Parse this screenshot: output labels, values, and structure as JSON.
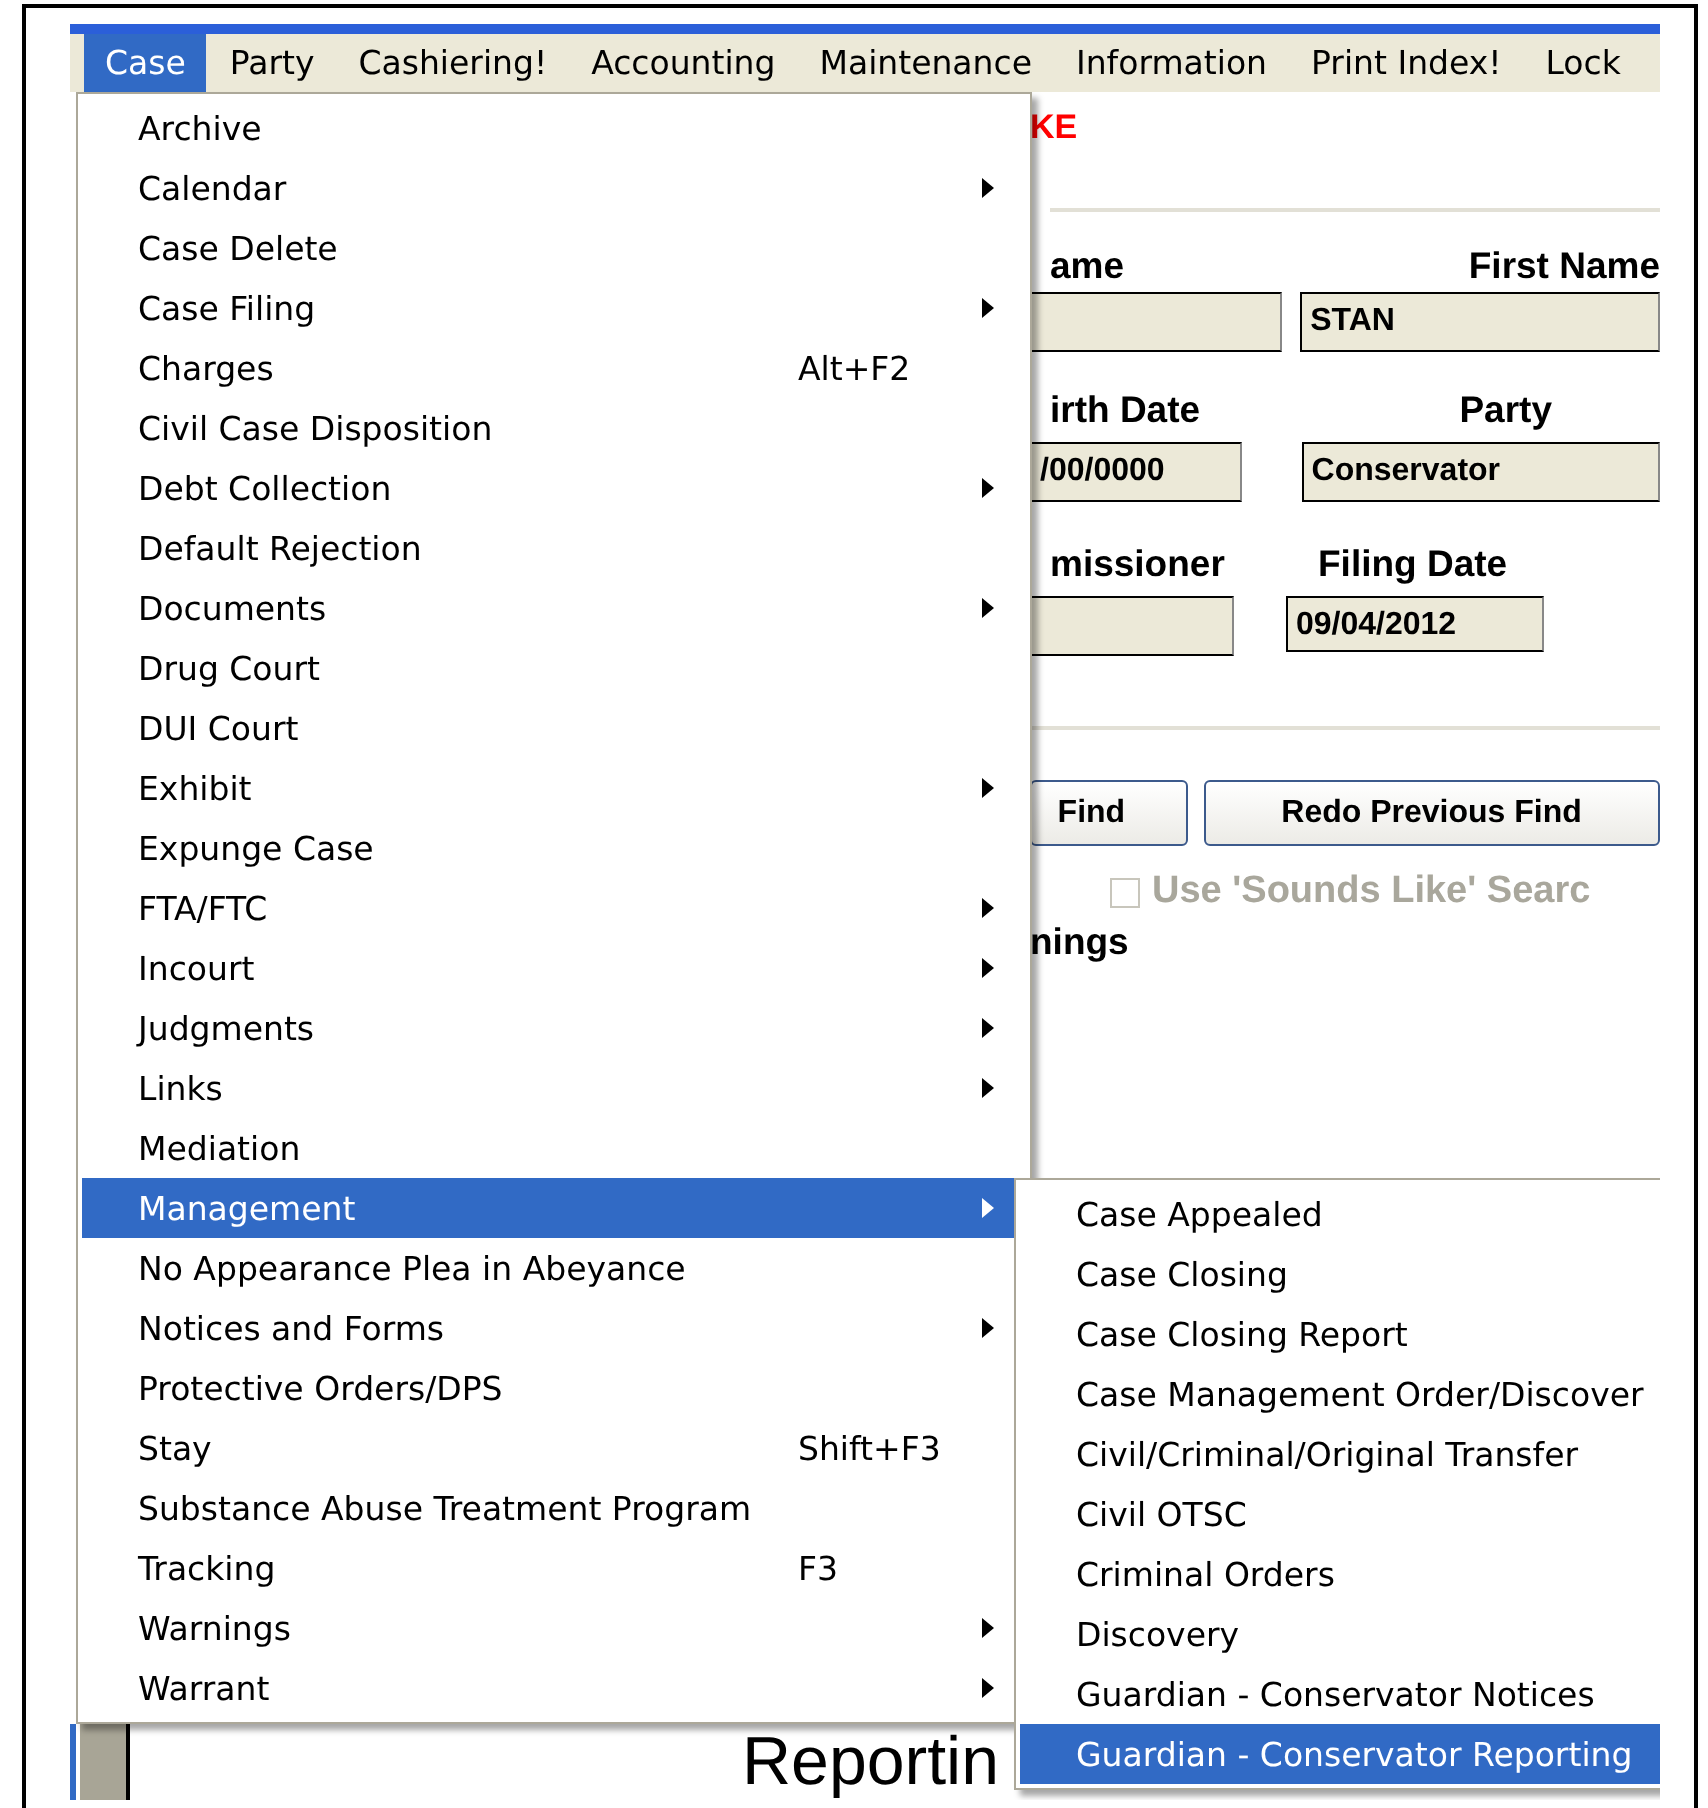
{
  "menubar": {
    "items": [
      {
        "label": "Case",
        "selected": true
      },
      {
        "label": "Party",
        "selected": false
      },
      {
        "label": "Cashiering!",
        "selected": false
      },
      {
        "label": "Accounting",
        "selected": false
      },
      {
        "label": "Maintenance",
        "selected": false
      },
      {
        "label": "Information",
        "selected": false
      },
      {
        "label": "Print Index!",
        "selected": false
      },
      {
        "label": "Lock",
        "selected": false
      }
    ]
  },
  "case_menu": {
    "items": [
      {
        "label": "Archive",
        "has_submenu": false,
        "selected": false
      },
      {
        "label": "Calendar",
        "has_submenu": true,
        "selected": false
      },
      {
        "label": "Case Delete",
        "has_submenu": false,
        "selected": false
      },
      {
        "label": "Case Filing",
        "has_submenu": true,
        "selected": false
      },
      {
        "label": "Charges",
        "shortcut": "Alt+F2",
        "has_submenu": false,
        "selected": false
      },
      {
        "label": "Civil Case Disposition",
        "has_submenu": false,
        "selected": false
      },
      {
        "label": "Debt Collection",
        "has_submenu": true,
        "selected": false
      },
      {
        "label": "Default Rejection",
        "has_submenu": false,
        "selected": false
      },
      {
        "label": "Documents",
        "has_submenu": true,
        "selected": false
      },
      {
        "label": "Drug Court",
        "has_submenu": false,
        "selected": false
      },
      {
        "label": "DUI Court",
        "has_submenu": false,
        "selected": false
      },
      {
        "label": "Exhibit",
        "has_submenu": true,
        "selected": false
      },
      {
        "label": "Expunge Case",
        "has_submenu": false,
        "selected": false
      },
      {
        "label": "FTA/FTC",
        "has_submenu": true,
        "selected": false
      },
      {
        "label": "Incourt",
        "has_submenu": true,
        "selected": false
      },
      {
        "label": "Judgments",
        "has_submenu": true,
        "selected": false
      },
      {
        "label": "Links",
        "has_submenu": true,
        "selected": false
      },
      {
        "label": "Mediation",
        "has_submenu": false,
        "selected": false
      },
      {
        "label": "Management",
        "has_submenu": true,
        "selected": true
      },
      {
        "label": "No Appearance Plea in Abeyance",
        "has_submenu": false,
        "selected": false
      },
      {
        "label": "Notices and Forms",
        "has_submenu": true,
        "selected": false
      },
      {
        "label": "Protective Orders/DPS",
        "has_submenu": false,
        "selected": false
      },
      {
        "label": "Stay",
        "shortcut": "Shift+F3",
        "has_submenu": false,
        "selected": false
      },
      {
        "label": "Substance Abuse Treatment Program",
        "has_submenu": false,
        "selected": false
      },
      {
        "label": "Tracking",
        "shortcut": "F3",
        "has_submenu": false,
        "selected": false
      },
      {
        "label": "Warnings",
        "has_submenu": true,
        "selected": false
      },
      {
        "label": "Warrant",
        "has_submenu": true,
        "selected": false
      }
    ]
  },
  "management_submenu": {
    "items": [
      {
        "label": "Case Appealed",
        "selected": false
      },
      {
        "label": "Case Closing",
        "selected": false
      },
      {
        "label": "Case Closing Report",
        "selected": false
      },
      {
        "label": "Case Management Order/Discover",
        "selected": false
      },
      {
        "label": "Civil/Criminal/Original Transfer",
        "selected": false
      },
      {
        "label": "Civil OTSC",
        "selected": false
      },
      {
        "label": "Criminal Orders",
        "selected": false
      },
      {
        "label": "Discovery",
        "selected": false
      },
      {
        "label": "Guardian - Conservator Notices",
        "selected": false
      },
      {
        "label": "Guardian - Conservator Reporting",
        "selected": true
      }
    ]
  },
  "form": {
    "banner": "KE",
    "rows": [
      {
        "labels": [
          "ame",
          "First Name"
        ],
        "fields": [
          {
            "kind": "blank"
          },
          {
            "kind": "text",
            "value": "STAN"
          }
        ]
      },
      {
        "labels": [
          "irth Date",
          "Party"
        ],
        "fields": [
          {
            "kind": "text",
            "value": "/00/0000"
          },
          {
            "kind": "text",
            "value": "Conservator"
          }
        ]
      },
      {
        "labels": [
          "missioner",
          "Filing Date"
        ],
        "fields": [
          {
            "kind": "blank"
          },
          {
            "kind": "text",
            "value": "09/04/2012"
          }
        ]
      }
    ],
    "buttons": [
      "Find",
      "Redo Previous Find"
    ],
    "checkbox": {
      "label": "Use 'Sounds Like' Searc",
      "checked": false,
      "disabled": true
    },
    "section_label": "nings",
    "footer_title": "Reportin"
  }
}
